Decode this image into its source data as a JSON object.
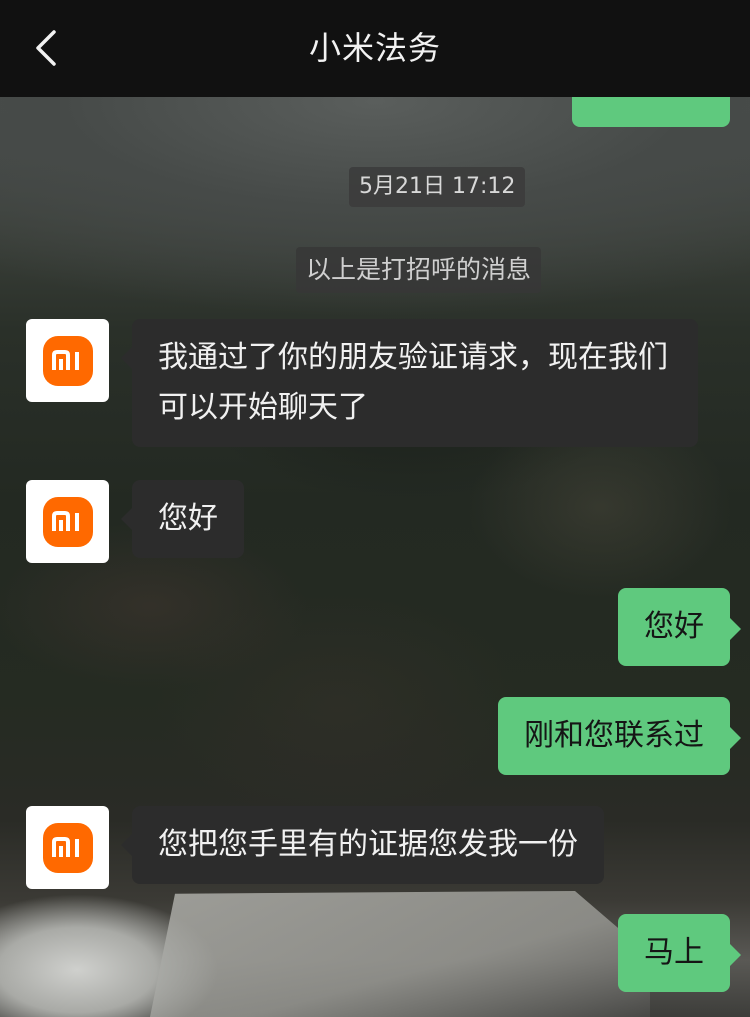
{
  "header": {
    "title": "小米法务",
    "back_icon": "chevron-left-icon"
  },
  "chat": {
    "timestamp": "5月21日 17:12",
    "system_message": "以上是打招呼的消息",
    "contact_avatar_icon": "xiaomi-logo-icon",
    "messages": [
      {
        "side": "in",
        "text": "我通过了你的朋友验证请求，现在我们可以开始聊天了"
      },
      {
        "side": "in",
        "text": "您好"
      },
      {
        "side": "out",
        "text": "您好"
      },
      {
        "side": "out",
        "text": "刚和您联系过"
      },
      {
        "side": "in",
        "text": "您把您手里有的证据您发我一份"
      },
      {
        "side": "out",
        "text": "马上"
      }
    ]
  },
  "colors": {
    "header_bg": "#111111",
    "incoming_bubble": "#2c2c2c",
    "outgoing_bubble": "#5fc97e",
    "xiaomi_orange": "#ff6900"
  }
}
